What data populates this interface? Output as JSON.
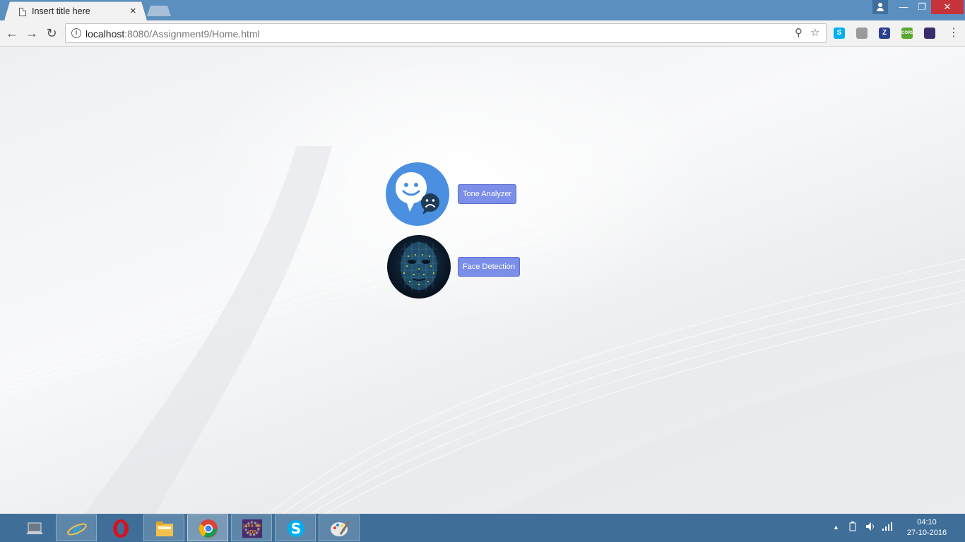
{
  "browser": {
    "tab_title": "Insert title here",
    "tab_close": "×",
    "url_host": "localhost",
    "url_rest": ":8080/Assignment9/Home.html",
    "window_controls": {
      "minimize": "—",
      "maximize": "❐",
      "close": "✕"
    },
    "nav": {
      "back": "←",
      "forward": "→",
      "reload": "↻"
    },
    "info_glyph": "i",
    "zoom_glyph": "⚲",
    "star_glyph": "☆",
    "menu_glyph": "⋮",
    "extensions": [
      {
        "name": "skype-extension-icon",
        "label": "S",
        "color": "#00aff0"
      },
      {
        "name": "ext-gray-icon",
        "label": "",
        "color": "#9a9a9a"
      },
      {
        "name": "zotero-extension-icon",
        "label": "Z",
        "color": "#2b3f8f"
      },
      {
        "name": "cors-extension-icon",
        "label": "CORS",
        "color": "#5aa82f"
      },
      {
        "name": "ext-purple-icon",
        "label": "",
        "color": "#3a2d6e"
      }
    ]
  },
  "page": {
    "apps": [
      {
        "icon": "tone-analyzer-icon",
        "button_label": "Tone Analyzer"
      },
      {
        "icon": "face-detection-icon",
        "button_label": "Face Detection"
      }
    ]
  },
  "taskbar": {
    "apps": [
      {
        "name": "taskbar-computer-icon",
        "color": "#ffffff"
      },
      {
        "name": "taskbar-ie-icon",
        "color": "#2aa7e0"
      },
      {
        "name": "taskbar-opera-icon",
        "color": "#d3141f"
      },
      {
        "name": "taskbar-file-explorer-icon",
        "color": "#f3c04d"
      },
      {
        "name": "taskbar-chrome-icon",
        "color": "#4285f4"
      },
      {
        "name": "taskbar-java-ee-ide-icon",
        "label": "Java EE IDE",
        "color": "#4a2a6a"
      },
      {
        "name": "taskbar-skype-icon",
        "label": "S",
        "color": "#00aff0"
      },
      {
        "name": "taskbar-paint-icon",
        "color": "#e8e8e8"
      }
    ],
    "tray_arrow": "▲",
    "clock_time": "04:10",
    "clock_date": "27-10-2016"
  }
}
